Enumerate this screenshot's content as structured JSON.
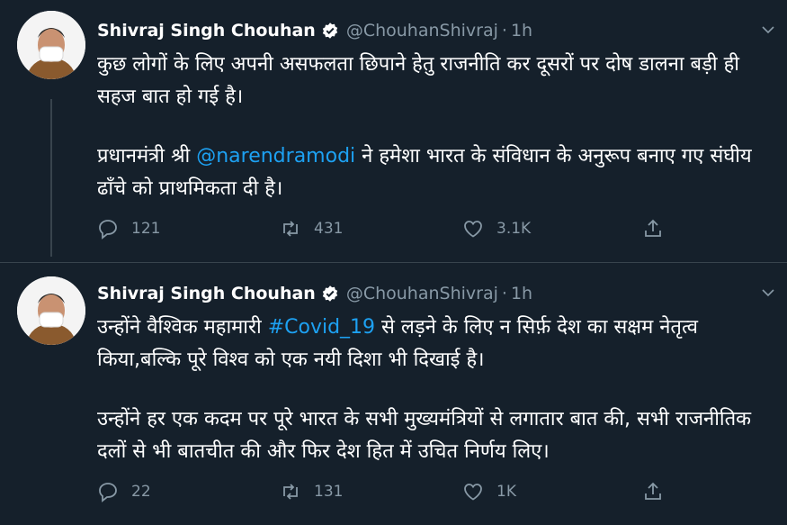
{
  "tweets": [
    {
      "author": "Shivraj Singh Chouhan",
      "handle": "@ChouhanShivraj",
      "separator": "·",
      "time": "1h",
      "para1": "कुछ लोगों के लिए अपनी असफलता छिपाने हेतु राजनीति कर दूसरों पर दोष डालना बड़ी ही सहज बात हो गई है।",
      "para2_before": "प्रधानमंत्री श्री ",
      "mention": "@narendramodi",
      "para2_after": " ने हमेशा भारत के संविधान के अनुरूप बनाए गए संघीय ढाँचे को प्राथमिकता दी है।",
      "replies": "121",
      "retweets": "431",
      "likes": "3.1K"
    },
    {
      "author": "Shivraj Singh Chouhan",
      "handle": "@ChouhanShivraj",
      "separator": "·",
      "time": "1h",
      "para1_before": "उन्होंने वैश्विक महामारी ",
      "hashtag": "#Covid_19",
      "para1_after": " से लड़ने के लिए न सिर्फ़ देश का सक्षम नेतृत्व किया,बल्कि पूरे विश्व को एक नयी दिशा भी दिखाई है।",
      "para2": "उन्होंने हर एक कदम पर पूरे भारत के सभी मुख्यमंत्रियों से लगातार बात की, सभी राजनीतिक दलों से भी बातचीत की और फिर देश हित में उचित निर्णय लिए।",
      "replies": "22",
      "retweets": "131",
      "likes": "1K"
    }
  ],
  "icons": {
    "verified": "verified-badge-icon",
    "caret": "chevron-down-icon",
    "reply": "reply-icon",
    "retweet": "retweet-icon",
    "like": "heart-icon",
    "share": "share-icon"
  },
  "colors": {
    "background": "#15202b",
    "accent": "#1da1f2",
    "secondary_text": "#8899a6",
    "divider": "#38444d"
  }
}
